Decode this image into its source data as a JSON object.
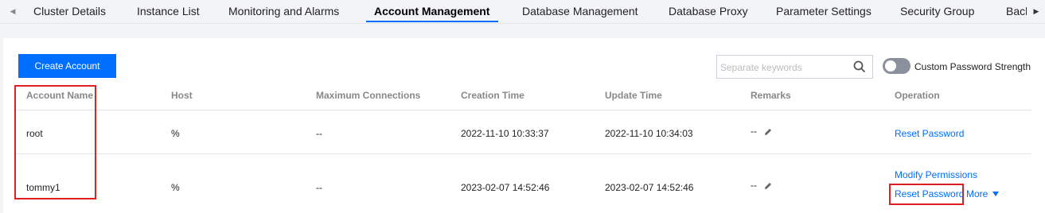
{
  "tabs": [
    "Cluster Details",
    "Instance List",
    "Monitoring and Alarms",
    "Account Management",
    "Database Management",
    "Database Proxy",
    "Parameter Settings",
    "Security Group",
    "Backup"
  ],
  "active_tab": "Account Management",
  "toolbar": {
    "create_label": "Create Account",
    "search_placeholder": "Separate keywords",
    "toggle_label": "Custom Password Strength"
  },
  "columns": [
    "Account Name",
    "Host",
    "Maximum Connections",
    "Creation Time",
    "Update Time",
    "Remarks",
    "Operation"
  ],
  "rows": [
    {
      "account": "root",
      "host": "%",
      "max_conn": "--",
      "created": "2022-11-10 10:33:37",
      "updated": "2022-11-10 10:34:03",
      "remarks": "--",
      "ops": [
        "Reset Password"
      ]
    },
    {
      "account": "tommy1",
      "host": "%",
      "max_conn": "--",
      "created": "2023-02-07 14:52:46",
      "updated": "2023-02-07 14:52:46",
      "remarks": "--",
      "ops": [
        "Modify Permissions",
        "Reset Password"
      ],
      "more": "More"
    }
  ],
  "colors": {
    "accent": "#006eff",
    "highlight": "#e02020"
  }
}
